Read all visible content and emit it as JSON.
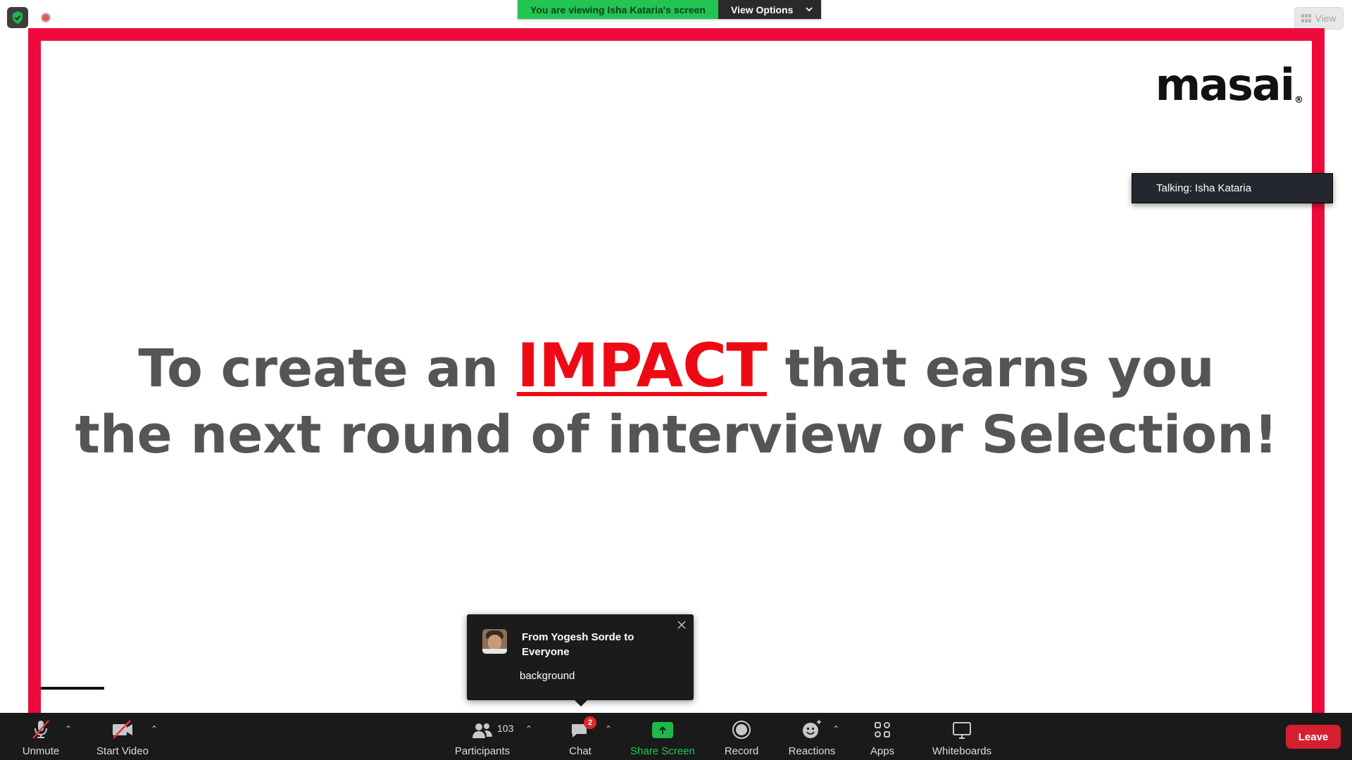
{
  "banner": {
    "viewing_text": "You are viewing Isha Kataria's screen",
    "view_options_label": "View Options"
  },
  "view_button": {
    "label": "View"
  },
  "slide": {
    "logo_text": "masai",
    "logo_mark": "®",
    "headline_before": "To create an",
    "headline_highlight": "IMPACT",
    "headline_after": "that earns you",
    "headline_line2": "the next round of interview or Selection!",
    "accent_color": "#ee0a3c",
    "highlight_color": "#ee0a14"
  },
  "talking_indicator": {
    "text": "Talking: Isha Kataria"
  },
  "chat_notification": {
    "from": "From Yogesh Sorde to Everyone",
    "message": "background"
  },
  "toolbar": {
    "unmute_label": "Unmute",
    "start_video_label": "Start Video",
    "participants_label": "Participants",
    "participants_count": "103",
    "chat_label": "Chat",
    "chat_badge": "2",
    "share_screen_label": "Share Screen",
    "record_label": "Record",
    "reactions_label": "Reactions",
    "apps_label": "Apps",
    "whiteboards_label": "Whiteboards",
    "leave_label": "Leave"
  },
  "colors": {
    "toolbar_bg": "#1a1a1a",
    "share_green": "#24c756",
    "leave_red": "#d42030",
    "banner_green": "#23c552"
  }
}
